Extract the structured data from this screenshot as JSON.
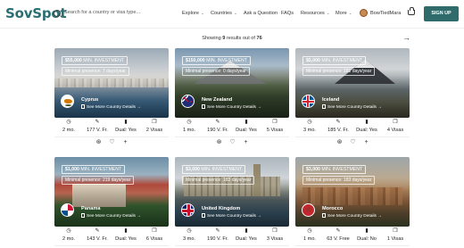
{
  "brand": {
    "logo_text": "SovSpot"
  },
  "search": {
    "placeholder": "Search for a country or visa type..."
  },
  "nav": {
    "items": [
      {
        "label": "Explore",
        "has_chevron": true
      },
      {
        "label": "Countries",
        "has_chevron": true
      },
      {
        "label": "Ask a Question",
        "has_chevron": false
      },
      {
        "label": "FAQs",
        "has_chevron": false
      },
      {
        "label": "Resources",
        "has_chevron": true
      },
      {
        "label": "More",
        "has_chevron": true
      }
    ],
    "user_name": "BowTiedMara",
    "signup_label": "SIGN UP"
  },
  "results": {
    "prefix": "Showing",
    "count": "9",
    "middle": "results out of",
    "total": "76"
  },
  "colors": {
    "brand": "#2a6f73",
    "signup_bg": "#2f6b6b"
  },
  "cards": [
    {
      "min": "$55,000",
      "min_label": "MIN. INVESTMENT",
      "presence": "Minimal presence: 7 days/year",
      "country": "Cyprus",
      "more": "See More Country Details →",
      "stats": [
        "2 mo.",
        "177 V. Fr.",
        "Dual: Yes",
        "2 Visas"
      ],
      "stat_icons": [
        "clock-icon",
        "passport-icon",
        "dual-passport-icon",
        "visa-cards-icon"
      ]
    },
    {
      "min": "$150,000",
      "min_label": "MIN. INVESTMENT",
      "presence": "Minimal presence: 0 days/year",
      "country": "New Zealand",
      "more": "See More Country Details →",
      "stats": [
        "1 mo.",
        "190 V. Fr.",
        "Dual: Yes",
        "5 Visas"
      ],
      "stat_icons": [
        "clock-icon",
        "passport-icon",
        "dual-passport-icon",
        "visa-cards-icon"
      ]
    },
    {
      "min": "$5,000",
      "min_label": "MIN. INVESTMENT",
      "presence": "Minimal presence: 181 days/year",
      "country": "Iceland",
      "more": "See More Country Details →",
      "stats": [
        "3 mo.",
        "185 V. Fr.",
        "Dual: Yes",
        "4 Visas"
      ],
      "stat_icons": [
        "clock-icon",
        "passport-icon",
        "dual-passport-icon",
        "visa-cards-icon"
      ]
    },
    {
      "min": "$1,000",
      "min_label": "MIN. INVESTMENT",
      "presence": "Minimal presence: 219 days/year",
      "country": "Panama",
      "more": "See More Country Details →",
      "stats": [
        "2 mo.",
        "143 V. Fr.",
        "Dual: Yes",
        "6 Visas"
      ],
      "stat_icons": [
        "clock-icon",
        "passport-icon",
        "dual-passport-icon",
        "visa-cards-icon"
      ]
    },
    {
      "min": "$3,000",
      "min_label": "MIN. INVESTMENT",
      "presence": "Minimal presence: 183 days/year",
      "country": "United Kingdom",
      "more": "See More Country Details →",
      "stats": [
        "3 mo.",
        "190 V. Fr.",
        "Dual: Yes",
        "3 Visas"
      ],
      "stat_icons": [
        "clock-icon",
        "passport-icon",
        "dual-passport-icon",
        "visa-cards-icon"
      ]
    },
    {
      "min": "$3,000",
      "min_label": "MIN. INVESTMENT",
      "presence": "Minimal presence: 183 days/year",
      "country": "Morocco",
      "more": "See More Country Details →",
      "stats": [
        "1 mo.",
        "63 V. Free",
        "Dual: No",
        "1 Visas"
      ],
      "stat_icons": [
        "clock-icon",
        "passport-icon",
        "dual-passport-icon",
        "visa-cards-icon"
      ]
    }
  ],
  "card_actions": [
    "compare-icon",
    "heart-icon",
    "add-icon"
  ]
}
